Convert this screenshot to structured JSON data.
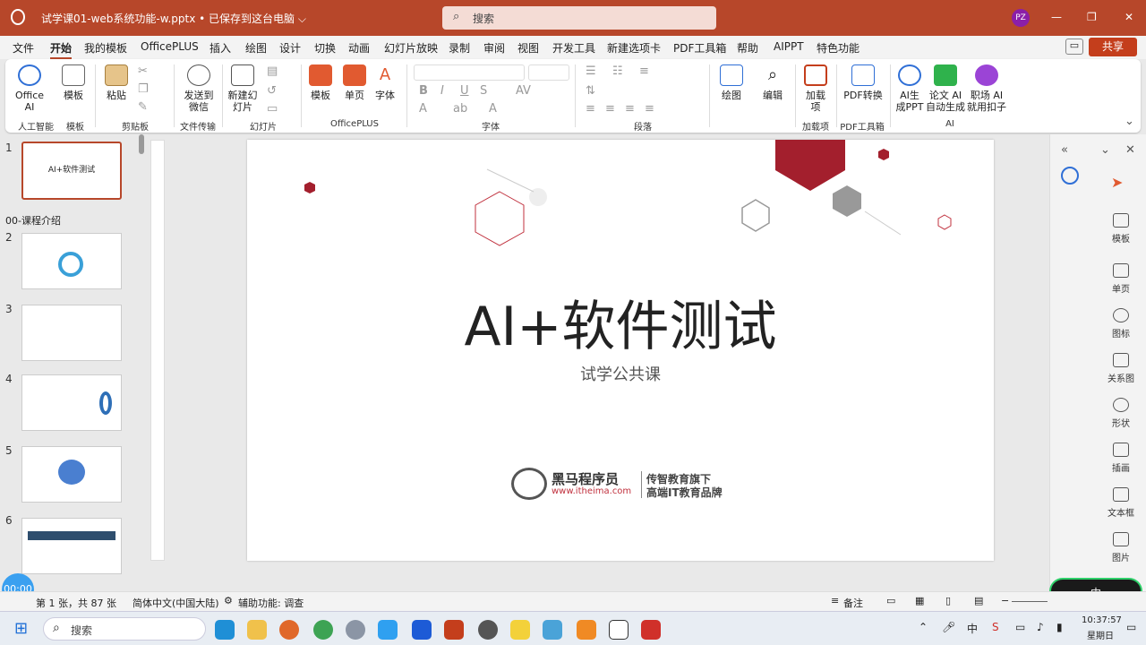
{
  "window": {
    "title": "试学课01-web系统功能-w.pptx • 已保存到这台电脑 ⌵",
    "search_placeholder": "搜索",
    "avatar": "PZ"
  },
  "menu": [
    "文件",
    "开始",
    "我的模板",
    "OfficePLUS",
    "插入",
    "绘图",
    "设计",
    "切换",
    "动画",
    "幻灯片放映",
    "录制",
    "审阅",
    "视图",
    "开发工具",
    "新建选项卡",
    "PDF工具箱",
    "帮助",
    "AIPPT",
    "特色功能"
  ],
  "share": "共享",
  "ribbon": {
    "office_ai": "Office AI",
    "template": "模板",
    "paste": "粘贴",
    "send_wechat": "发送到微信",
    "new_slide": "新建幻灯片",
    "template2": "模板",
    "single_page": "单页",
    "font_btn": "字体",
    "draw": "绘图",
    "edit": "编辑",
    "addin": "加载项",
    "pdf_convert": "PDF转换",
    "ai_ppt": "AI生成PPT",
    "paper_ai": "论文 AI 自动生成",
    "koozi_ai": "职场 AI 就用扣子",
    "groups": {
      "ai": "人工智能",
      "tpl": "模板",
      "clipboard": "剪贴板",
      "filetx": "文件传输",
      "slides": "幻灯片",
      "officeplus": "OfficePLUS",
      "font": "字体",
      "paragraph": "段落",
      "addins": "加载项",
      "pdftools": "PDF工具箱",
      "ai2": "AI"
    }
  },
  "thumbnails": {
    "section": "00-课程介绍",
    "nums": [
      "1",
      "2",
      "3",
      "4",
      "5",
      "6"
    ],
    "thumb1_title": "AI+软件测试"
  },
  "slide": {
    "title": "AI+软件测试",
    "subtitle": "试学公共课",
    "logo_name": "黑马程序员",
    "logo_url": "www.itheima.com",
    "logo_slogan1": "传智教育旗下",
    "logo_slogan2": "高端IT教育品牌"
  },
  "right_pane": [
    "模板",
    "单页",
    "图标",
    "关系图",
    "形状",
    "插画",
    "文本框",
    "图片"
  ],
  "status": {
    "slide_info": "第 1 张，共 87 张",
    "language": "简体中文(中国大陆)",
    "accessibility": "辅助功能: 调查",
    "notes": "备注",
    "timer": "00:00"
  },
  "taskbar": {
    "search": "搜索",
    "time": "10:37:57",
    "day": "星期日",
    "ime": "中"
  },
  "colors": {
    "accent": "#b7472a",
    "hex_red": "#a31f2d"
  }
}
